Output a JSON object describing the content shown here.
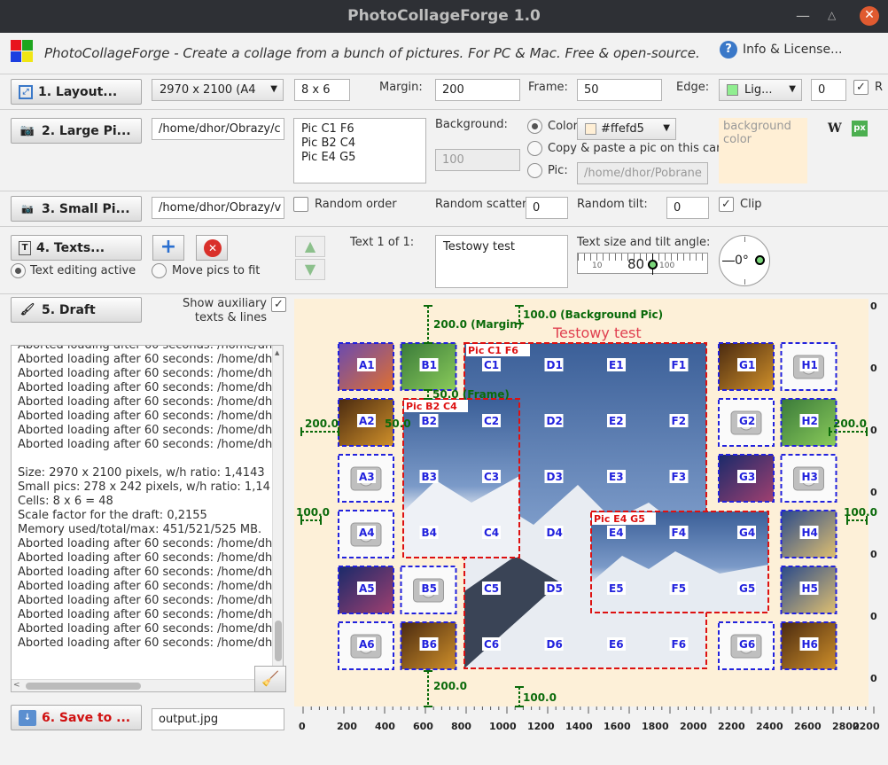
{
  "window": {
    "title": "PhotoCollageForge 1.0"
  },
  "header": {
    "subtitle": "PhotoCollageForge - Create a collage from a bunch of pictures. For PC & Mac. Free & open-source.",
    "info": "Info & License..."
  },
  "row1": {
    "layout_btn": "1. Layout...",
    "size_value": "2970 x 2100  (A4",
    "grid_value": "8 x 6",
    "margin_label": "Margin:",
    "margin_value": "200",
    "frame_label": "Frame:",
    "frame_value": "50",
    "edge_label": "Edge:",
    "edge_value": "Lig...",
    "edge_num": "0",
    "r_label": "R"
  },
  "row2": {
    "large_btn": "2. Large Pi...",
    "path": "/home/dhor/Obrazy/c",
    "pics": [
      "Pic C1 F6",
      "Pic B2 C4",
      "Pic E4 G5"
    ],
    "bg_label": "Background:",
    "bg_value": "100",
    "color_label": "Color",
    "color_value": "#ffefd5",
    "copy_label": "Copy & paste a pic on this car",
    "pic_label": "Pic:",
    "pic_path": "/home/dhor/Pobrane",
    "bg_hint": "background color",
    "w_icon": "W",
    "px_icon": "px"
  },
  "row3": {
    "small_btn": "3. Small Pi...",
    "path": "/home/dhor/Obrazy/v",
    "random_order": "Random order",
    "scatter_label": "Random scatter",
    "scatter_value": "0",
    "tilt_label": "Random tilt:",
    "tilt_value": "0",
    "clip_label": "Clip"
  },
  "row4": {
    "texts_btn": "4. Texts...",
    "text_editing": "Text editing active",
    "move_pics": "Move pics to fit",
    "text_of": "Text 1 of 1:",
    "text_value": "Testowy test",
    "size_label": "Text size and tilt angle:",
    "ruler_value": "80",
    "ruler_t1": "10",
    "ruler_t2": "100",
    "angle_value": "0°"
  },
  "row5": {
    "draft_btn": "5. Draft",
    "show_aux": "Show auxiliary",
    "show_aux2": "texts & lines"
  },
  "log": {
    "lines": [
      "Aborted loading after 60 seconds: /home/dh",
      "Aborted loading after 60 seconds: /home/dh",
      "Aborted loading after 60 seconds: /home/dh",
      "Aborted loading after 60 seconds: /home/dh",
      "Aborted loading after 60 seconds: /home/dh",
      "Aborted loading after 60 seconds: /home/dh",
      "Aborted loading after 60 seconds: /home/dh",
      "Aborted loading after 60 seconds: /home/dh",
      "",
      "Size: 2970 x 2100 pixels, w/h ratio: 1,4143",
      "Small pics: 278 x 242 pixels, w/h ratio: 1,14",
      "Cells: 8 x 6 = 48",
      "Scale factor for the draft: 0,2155",
      "Memory used/total/max:  451/521/525 MB.",
      "Aborted loading after 60 seconds: /home/dh",
      "Aborted loading after 60 seconds: /home/dh",
      "Aborted loading after 60 seconds: /home/dh",
      "Aborted loading after 60 seconds: /home/dh",
      "Aborted loading after 60 seconds: /home/dh",
      "Aborted loading after 60 seconds: /home/dh",
      "Aborted loading after 60 seconds: /home/dh",
      "Aborted loading after 60 seconds: /home/dh"
    ]
  },
  "save": {
    "btn": "6. Save to ...",
    "file": "output.jpg"
  },
  "draft": {
    "title_text": "Testowy test",
    "dims": {
      "margin_top": "200.0 (Margin)",
      "bg_top": "100.0 (Background Pic)",
      "frame": "50.0 (Frame)",
      "left": "200.0",
      "right": "200.0",
      "left2": "100.0",
      "right2": "100.0",
      "bottom": "200.0",
      "bottom2": "100.0",
      "small50": "50.0"
    },
    "large_pics": [
      {
        "label": "Pic C1 F6"
      },
      {
        "label": "Pic B2 C4"
      },
      {
        "label": "Pic E4 G5"
      }
    ],
    "cols": [
      "A",
      "B",
      "C",
      "D",
      "E",
      "F",
      "G",
      "H"
    ],
    "rows": [
      "1",
      "2",
      "3",
      "4",
      "5",
      "6"
    ],
    "xticks": [
      "0",
      "200",
      "400",
      "600",
      "800",
      "1000",
      "1200",
      "1400",
      "1600",
      "1800",
      "2000",
      "2200",
      "2400",
      "2600",
      "2800",
      "2200"
    ],
    "yticks": [
      "0",
      "0",
      "0",
      "0",
      "0",
      "0",
      "0"
    ],
    "colors": {
      "cell_border": "#2222dd",
      "large_border": "#dd1111",
      "dim": "#0a6a0a",
      "title": "#e04050",
      "bg": "#fdf0d8"
    }
  }
}
